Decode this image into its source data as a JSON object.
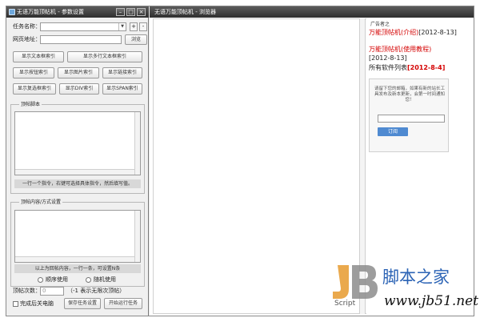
{
  "settings_window": {
    "title": "无语万能顶帖机 - 参数设置",
    "task_name_label": "任务名称：",
    "url_label": "网页地址：",
    "plus": "+",
    "minus": "-",
    "browse_button": "浏览",
    "buttons_row1": [
      "显示文本框索引",
      "显示多行文本框索引"
    ],
    "buttons_row2": [
      "显示按钮索引",
      "显示图片索引",
      "显示链接索引"
    ],
    "buttons_row3": [
      "显示复选框索引",
      "显示DIV索引",
      "显示SPAN索引"
    ],
    "script_group_title": "顶帖脚本",
    "script_hint": "一行一个指令，右键可选择具体指令，然后填写值。",
    "content_group_title": "顶帖内容/方式设置",
    "content_hint": "以上为回帖内容，一行一条，可设置N条",
    "order_label": "顺序使用",
    "random_label": "随机使用",
    "count_label": "顶帖次数：",
    "count_value": "0",
    "count_note": "（-1 表示无限次顶帖）",
    "shutdown_label": "完成后关电脑",
    "save_button": "保存任务设置",
    "run_button": "开始运行任务"
  },
  "browser_window": {
    "title": "无语万能顶帖机 - 浏览器",
    "ad_header": "广告者之",
    "ad_link1": "万能顶帖机(介绍)",
    "ad_date1": "[2012-8-13]",
    "ad_link2": "万能顶帖机(使用教程)",
    "ad_date2": "[2012-8-13]",
    "ad_list": "所有软件列表",
    "ad_list_date": "[2012-8-4]",
    "subscribe_text": "请留下您的邮箱，如果有新的站长工具发布及新本更新，会第一时间通知您！",
    "subscribe_button": "订阅"
  },
  "watermark": {
    "logo_letters": "JB",
    "logo_word": "Script",
    "site_cn": "脚本之家",
    "site_url": "www.jb51.net"
  }
}
